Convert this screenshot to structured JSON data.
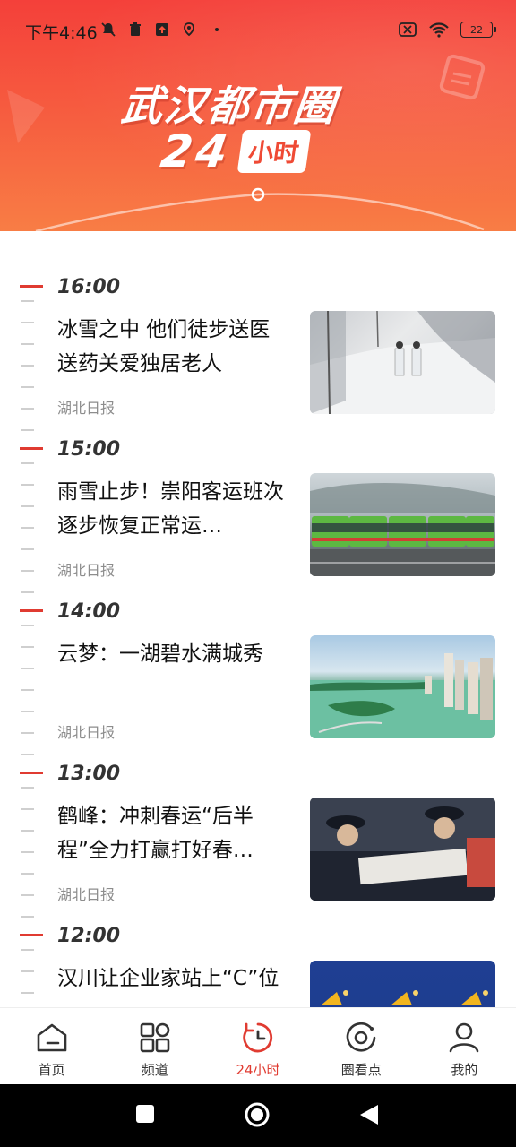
{
  "status_bar": {
    "time": "下午4:46",
    "battery": "22"
  },
  "banner": {
    "title_line1": "武汉都市圈",
    "title_number": "24",
    "title_pill": "小时"
  },
  "entries": [
    {
      "time": "16:00",
      "title": "冰雪之中 他们徒步送医送药关爱独居老人",
      "source": "湖北日报"
    },
    {
      "time": "15:00",
      "title": "雨雪止步！崇阳客运班次逐步恢复正常运…",
      "source": "湖北日报"
    },
    {
      "time": "14:00",
      "title": "云梦：一湖碧水满城秀",
      "source": "湖北日报"
    },
    {
      "time": "13:00",
      "title": "鹤峰：冲刺春运“后半程”全力打赢打好春…",
      "source": "湖北日报"
    },
    {
      "time": "12:00",
      "title": "汉川让企业家站上“C”位",
      "source": ""
    }
  ],
  "bottom_nav": {
    "items": [
      {
        "label": "首页",
        "icon": "home-icon"
      },
      {
        "label": "频道",
        "icon": "channels-grid-icon"
      },
      {
        "label": "24小时",
        "icon": "clock-24h-icon"
      },
      {
        "label": "圈看点",
        "icon": "circle-view-icon"
      },
      {
        "label": "我的",
        "icon": "profile-icon"
      }
    ],
    "active_index": 2
  },
  "colors": {
    "accent": "#e03b31",
    "banner_top": "#f4403a",
    "banner_bottom": "#f87d45"
  }
}
